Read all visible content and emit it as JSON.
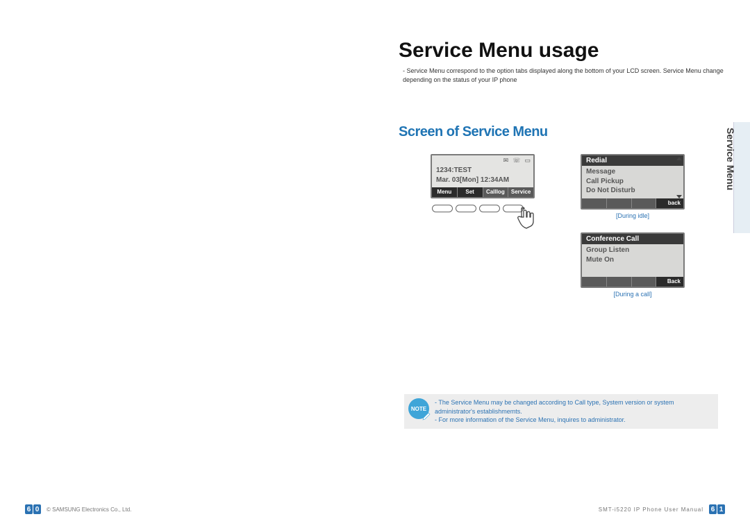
{
  "header": {
    "title": "Service Menu usage",
    "intro_1": "Service Menu correspond to the option tabs displayed along the bottom of your LCD screen. Service Menu change depending on the status of your IP phone",
    "section_title": "Screen of Service Menu"
  },
  "tab": {
    "label": "Service Menu"
  },
  "lcd1": {
    "line1": "1234:TEST",
    "line2": "Mar. 03[Mon] 12:34AM",
    "sk1": "Menu",
    "sk2": "Set",
    "sk3": "Calllog",
    "sk4": "Service"
  },
  "lcd2": {
    "header": "Redial",
    "row1": "Message",
    "row2": "Call Pickup",
    "row3": "Do Not Disturb",
    "sk_right": "back",
    "caption": "[During idle]"
  },
  "lcd3": {
    "header": "Conference Call",
    "row1": "Group Listen",
    "row2": "Mute On",
    "sk_right": "Back",
    "caption": "[During a call]"
  },
  "note": {
    "badge": "NOTE",
    "line1": "The Service Menu may be changed according to Call type, System version or system administrator's establishmemts.",
    "line2": "For more information of the Service Menu, inquires to administrator."
  },
  "footer": {
    "left_page_d1": "6",
    "left_page_d2": "0",
    "right_page_d1": "6",
    "right_page_d2": "1",
    "copyright": "© SAMSUNG Electronics Co., Ltd.",
    "manual": "SMT-i5220 IP Phone User Manual"
  }
}
